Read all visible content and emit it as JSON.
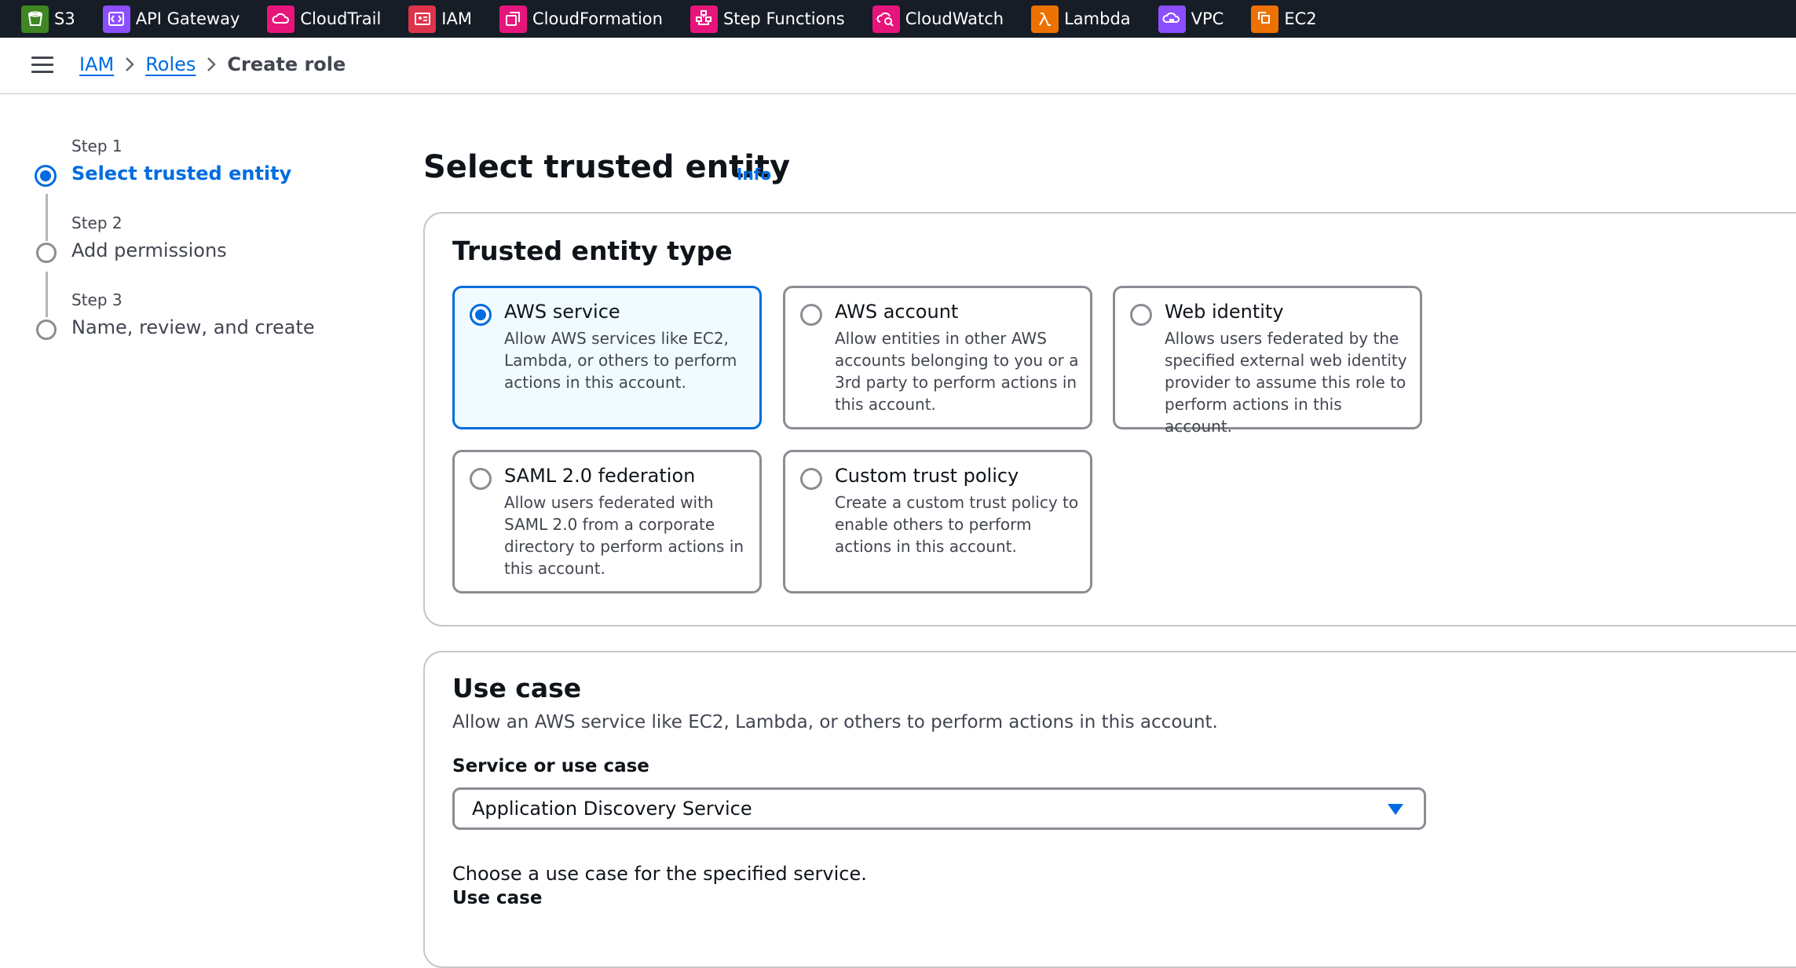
{
  "topbar": {
    "services": [
      {
        "label": "S3",
        "icon": "s3-bucket-icon",
        "color": "#3f8624"
      },
      {
        "label": "API Gateway",
        "icon": "api-gateway-icon",
        "color": "#8c4fff"
      },
      {
        "label": "CloudTrail",
        "icon": "cloudtrail-icon",
        "color": "#e7157b"
      },
      {
        "label": "IAM",
        "icon": "iam-icon",
        "color": "#dd344c"
      },
      {
        "label": "CloudFormation",
        "icon": "cloudformation-icon",
        "color": "#e7157b"
      },
      {
        "label": "Step Functions",
        "icon": "step-functions-icon",
        "color": "#e7157b"
      },
      {
        "label": "CloudWatch",
        "icon": "cloudwatch-icon",
        "color": "#e7157b"
      },
      {
        "label": "Lambda",
        "icon": "lambda-icon",
        "color": "#ed7100"
      },
      {
        "label": "VPC",
        "icon": "vpc-icon",
        "color": "#8c4fff"
      },
      {
        "label": "EC2",
        "icon": "ec2-icon",
        "color": "#ed7100"
      }
    ]
  },
  "breadcrumb": {
    "items": [
      "IAM",
      "Roles"
    ],
    "current": "Create role"
  },
  "steps": [
    {
      "number": "Step 1",
      "name": "Select trusted entity",
      "active": true
    },
    {
      "number": "Step 2",
      "name": "Add permissions",
      "active": false
    },
    {
      "number": "Step 3",
      "name": "Name, review, and create",
      "active": false
    }
  ],
  "page": {
    "title": "Select trusted entity",
    "info": "Info"
  },
  "trusted_entity": {
    "heading": "Trusted entity type",
    "options": [
      {
        "title": "AWS service",
        "description": "Allow AWS services like EC2, Lambda, or others to perform actions in this account.",
        "selected": true
      },
      {
        "title": "AWS account",
        "description": "Allow entities in other AWS accounts belonging to you or a 3rd party to perform actions in this account.",
        "selected": false
      },
      {
        "title": "Web identity",
        "description": "Allows users federated by the specified external web identity provider to assume this role to perform actions in this account.",
        "selected": false
      },
      {
        "title": "SAML 2.0 federation",
        "description": "Allow users federated with SAML 2.0 from a corporate directory to perform actions in this account.",
        "selected": false
      },
      {
        "title": "Custom trust policy",
        "description": "Create a custom trust policy to enable others to perform actions in this account.",
        "selected": false
      }
    ]
  },
  "use_case": {
    "heading": "Use case",
    "description": "Allow an AWS service like EC2, Lambda, or others to perform actions in this account.",
    "service_label": "Service or use case",
    "service_value": "Application Discovery Service",
    "choose_text": "Choose a use case for the specified service.",
    "use_case_label": "Use case"
  },
  "colors": {
    "accent": "#006ce0",
    "topbar_bg": "#161d26",
    "selected_bg": "#f0fbff"
  }
}
